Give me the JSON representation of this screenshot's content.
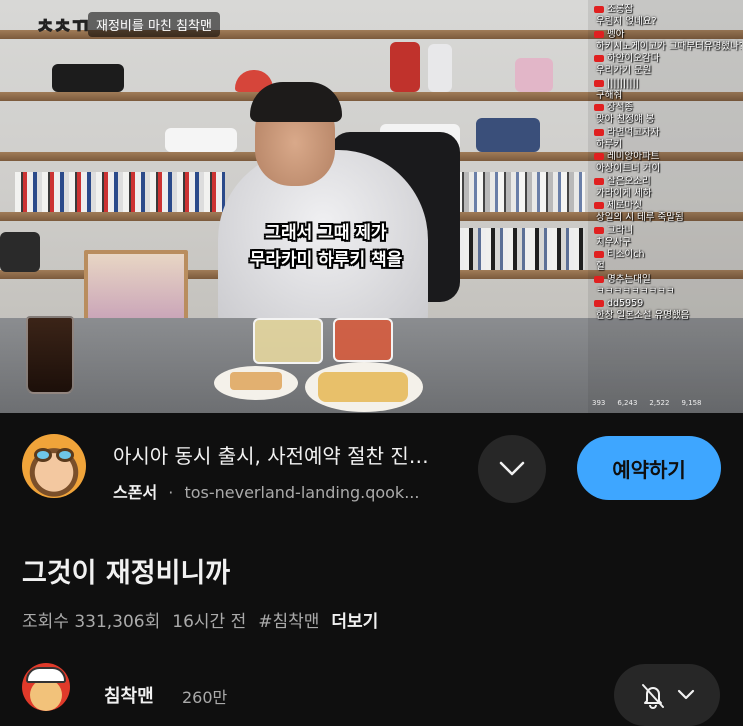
{
  "video_overlay": {
    "watermark": "ㅊㅊㄲ",
    "stream_title": "재정비를 마친 침착맨",
    "caption_line1": "그래서 그때 제가",
    "caption_line2": "무라카미 하루키 책을"
  },
  "chat": {
    "messages": [
      {
        "nick": "조롱잡",
        "text": "우림지 얹네요?"
      },
      {
        "nick": "펭아",
        "text": "하키시노게이고가 그때부터유명했나?"
      },
      {
        "nick": "하얀이오감다",
        "text": "우리가기 문원"
      },
      {
        "nick": "||||||||||",
        "text": "구해줘"
      },
      {
        "nick": "장석종",
        "text": "맞아 친정얘 봉"
      },
      {
        "nick": "라면먹고자자",
        "text": "하루키"
      },
      {
        "nick": "레미앙아파트",
        "text": "아상이트너 거이"
      },
      {
        "nick": "살은오소리",
        "text": "가라이게 세하"
      },
      {
        "nick": "제로마싯",
        "text": "상일의 시 테루 죽말됨"
      },
      {
        "nick": "그라니",
        "text": "치우사구"
      },
      {
        "nick": "티소이ch",
        "text": "헐"
      },
      {
        "nick": "명추는대일",
        "text": "ㅋㅋㅋㅋㅋㅋㅋㅋㅋ"
      },
      {
        "nick": "dd5959",
        "text": "한창 일본소설 유명했음"
      }
    ],
    "stats": [
      "393",
      "6,243",
      "2,522",
      "9,158"
    ]
  },
  "ad": {
    "title": "아시아 동시 출시, 사전예약 절찬 진…",
    "sponsor_label": "스폰서",
    "separator": "·",
    "url": "tos-neverland-landing.qook...",
    "cta_label": "예약하기",
    "accent_color": "#3ea6ff"
  },
  "video": {
    "title": "그것이 재정비니까",
    "views": "조회수 331,306회",
    "time_ago": "16시간 전",
    "hashtag": "#침착맨",
    "more_label": "더보기"
  },
  "channel": {
    "name": "침착맨",
    "subscribers": "260만"
  },
  "icons": {
    "expand": "chevron-down-icon",
    "notify": "bell-off-icon"
  }
}
